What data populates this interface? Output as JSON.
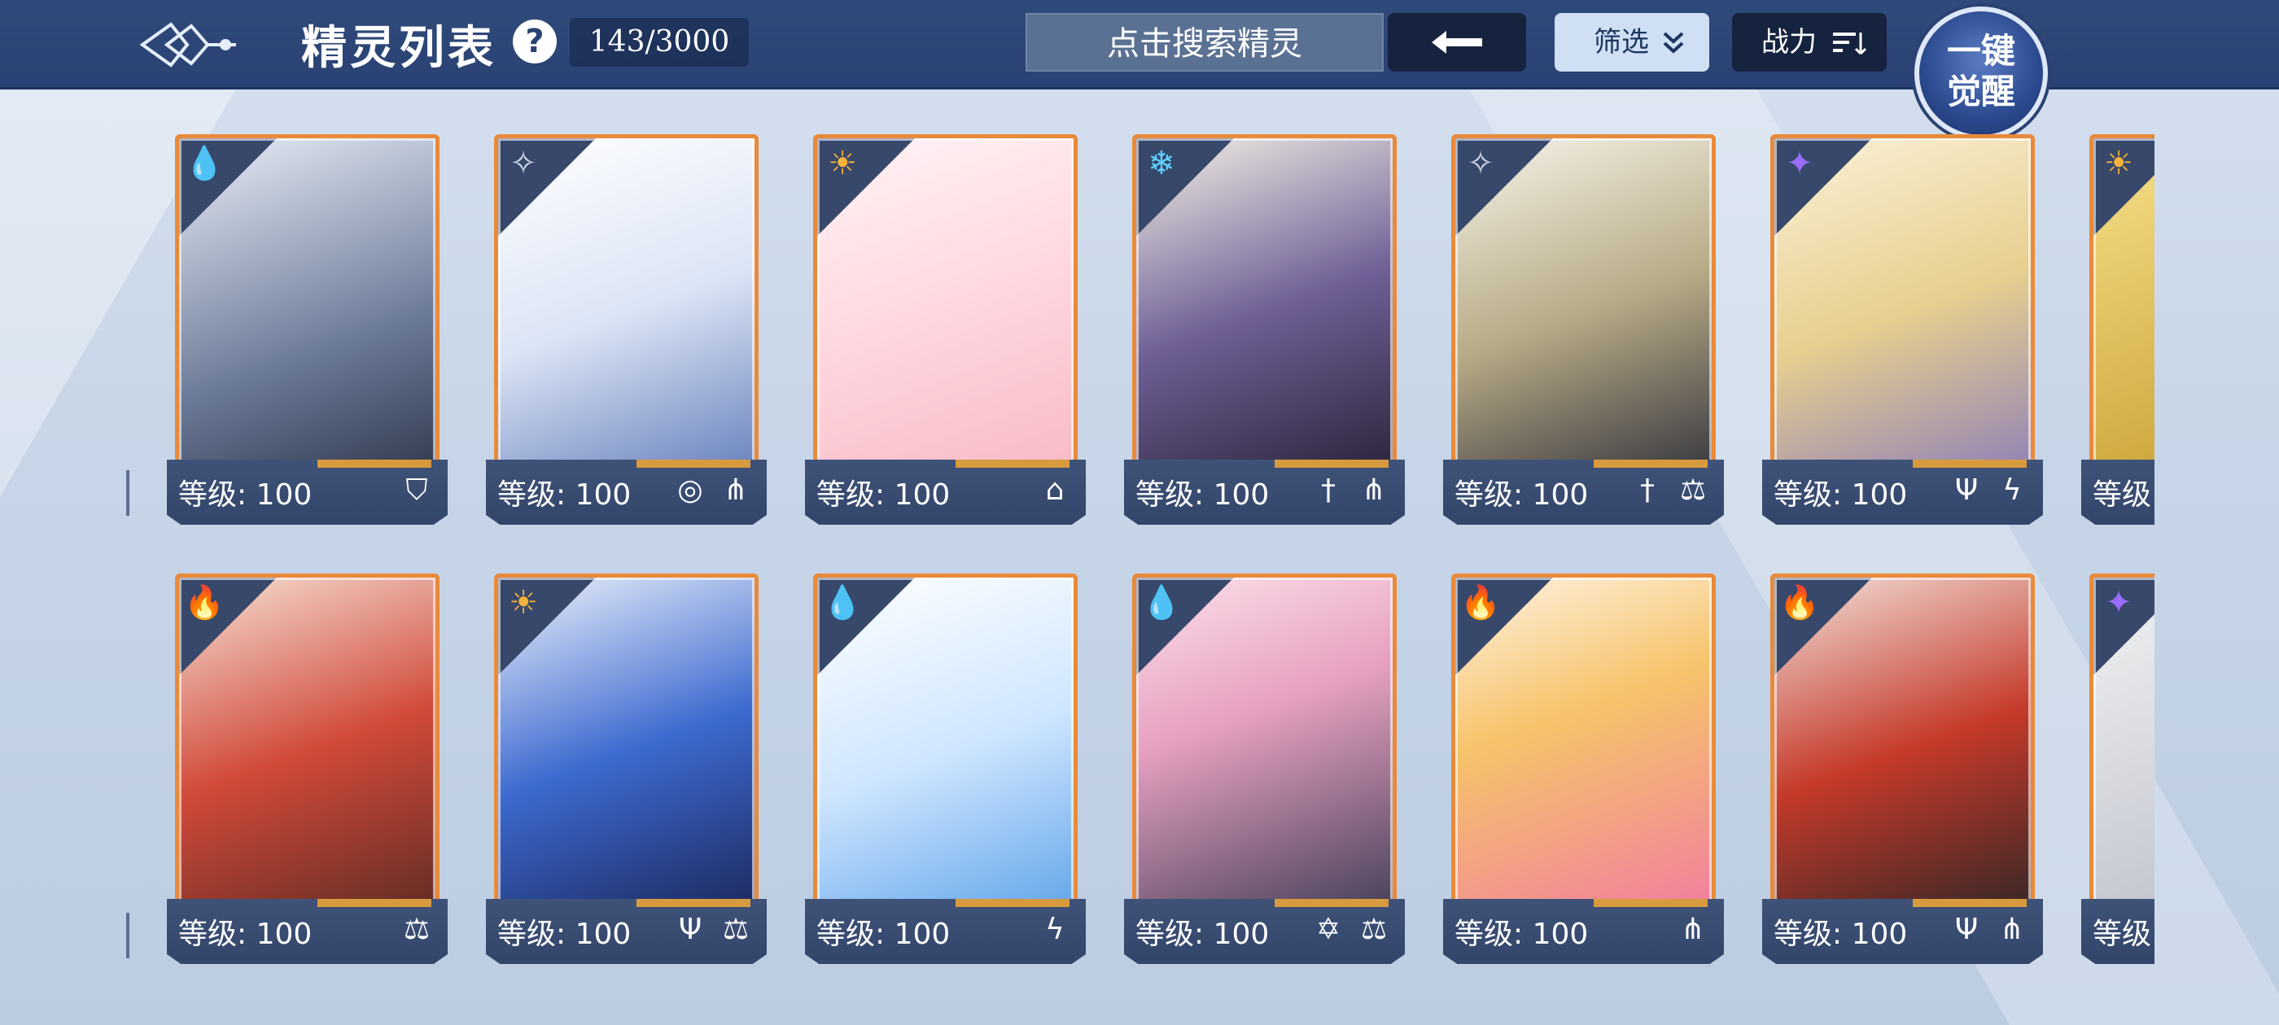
{
  "header": {
    "title": "精灵列表",
    "help_label": "?",
    "count": "143/3000",
    "search_label": "点击搜索精灵",
    "filter_label": "筛选",
    "power_label": "战力",
    "awaken_line1": "一键",
    "awaken_line2": "觉醒"
  },
  "colors": {
    "frame_orange": "#e98a3a",
    "bar_navy": "#2a4273",
    "water": "#6fa7ff",
    "fire": "#ff5a5a",
    "light": "#f7b23b",
    "dark": "#9a6dff",
    "ice": "#5fd1ff",
    "neutral": "#cfd6e3"
  },
  "cards": [
    {
      "element": "water-icon",
      "level": "等级: 100",
      "skills": [
        "shield-icon"
      ]
    },
    {
      "element": "neutral-icon",
      "level": "等级: 100",
      "skills": [
        "vortex-icon",
        "claw-icon"
      ]
    },
    {
      "element": "light-icon",
      "level": "等级: 100",
      "skills": [
        "tower-icon"
      ]
    },
    {
      "element": "ice-icon",
      "level": "等级: 100",
      "skills": [
        "sword-icon",
        "claw-icon"
      ]
    },
    {
      "element": "neutral-icon",
      "level": "等级: 100",
      "skills": [
        "sword-icon",
        "scale-icon"
      ]
    },
    {
      "element": "dark-icon",
      "level": "等级: 100",
      "skills": [
        "trident-icon",
        "lightning-icon"
      ]
    },
    {
      "element": "light-icon",
      "level": "等级",
      "skills": []
    },
    {
      "element": "fire-icon",
      "level": "等级: 100",
      "skills": [
        "scale-icon"
      ]
    },
    {
      "element": "light-icon",
      "level": "等级: 100",
      "skills": [
        "trident-icon",
        "scale-icon"
      ]
    },
    {
      "element": "water-icon",
      "level": "等级: 100",
      "skills": [
        "lightning-icon"
      ]
    },
    {
      "element": "water-icon",
      "level": "等级: 100",
      "skills": [
        "star-icon",
        "scale-icon"
      ]
    },
    {
      "element": "fire-icon",
      "level": "等级: 100",
      "skills": [
        "claw-icon"
      ]
    },
    {
      "element": "fire-icon",
      "level": "等级: 100",
      "skills": [
        "trident-icon",
        "claw-icon"
      ]
    },
    {
      "element": "dark-icon",
      "level": "等级",
      "skills": []
    }
  ]
}
